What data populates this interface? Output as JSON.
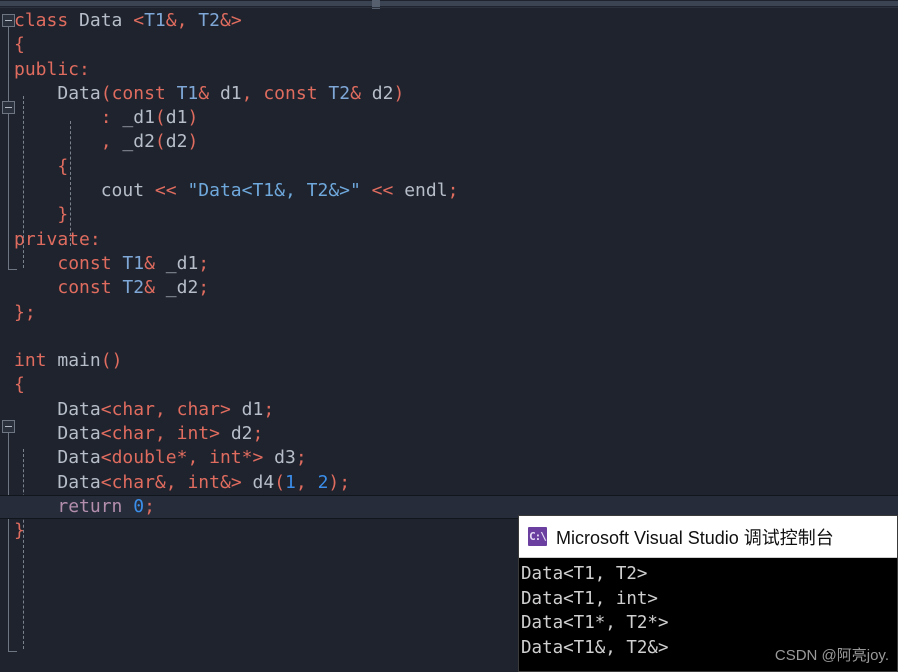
{
  "editor": {
    "background": "#1e232d",
    "highlighted_line_index": 20,
    "lines": [
      {
        "indent": 0,
        "text": "class Data <T1&, T2&>"
      },
      {
        "indent": 0,
        "text": "{"
      },
      {
        "indent": 0,
        "text": "public:"
      },
      {
        "indent": 1,
        "text": "Data(const T1& d1, const T2& d2)"
      },
      {
        "indent": 2,
        "text": ": _d1(d1)"
      },
      {
        "indent": 2,
        "text": ", _d2(d2)"
      },
      {
        "indent": 1,
        "text": "{"
      },
      {
        "indent": 2,
        "text": "cout << \"Data<T1&, T2&>\" << endl;"
      },
      {
        "indent": 1,
        "text": "}"
      },
      {
        "indent": 0,
        "text": "private:"
      },
      {
        "indent": 1,
        "text": "const T1& _d1;"
      },
      {
        "indent": 1,
        "text": "const T2& _d2;"
      },
      {
        "indent": 0,
        "text": "};"
      },
      {
        "indent": 0,
        "text": ""
      },
      {
        "indent": 0,
        "text": "int main()"
      },
      {
        "indent": 0,
        "text": "{"
      },
      {
        "indent": 1,
        "text": "Data<char, char> d1;"
      },
      {
        "indent": 1,
        "text": "Data<char, int> d2;"
      },
      {
        "indent": 1,
        "text": "Data<double*, int*> d3;"
      },
      {
        "indent": 1,
        "text": "Data<char&, int&> d4(1, 2);"
      },
      {
        "indent": 1,
        "text": "return 0;"
      },
      {
        "indent": 0,
        "text": "}"
      }
    ],
    "colors": {
      "keyword": "#e06c5f",
      "type_param": "#7fa8d8",
      "identifier": "#b7bec9",
      "string": "#6fa8dc",
      "number": "#3b8eea",
      "return_keyword": "#b48ead"
    }
  },
  "console": {
    "title": "Microsoft Visual Studio 调试控制台",
    "icon": "cmd-console-icon",
    "icon_text": "C:\\",
    "output": [
      "Data<T1, T2>",
      "Data<T1, int>",
      "Data<T1*, T2*>",
      "Data<T1&, T2&>"
    ],
    "watermark": "CSDN @阿亮joy."
  }
}
